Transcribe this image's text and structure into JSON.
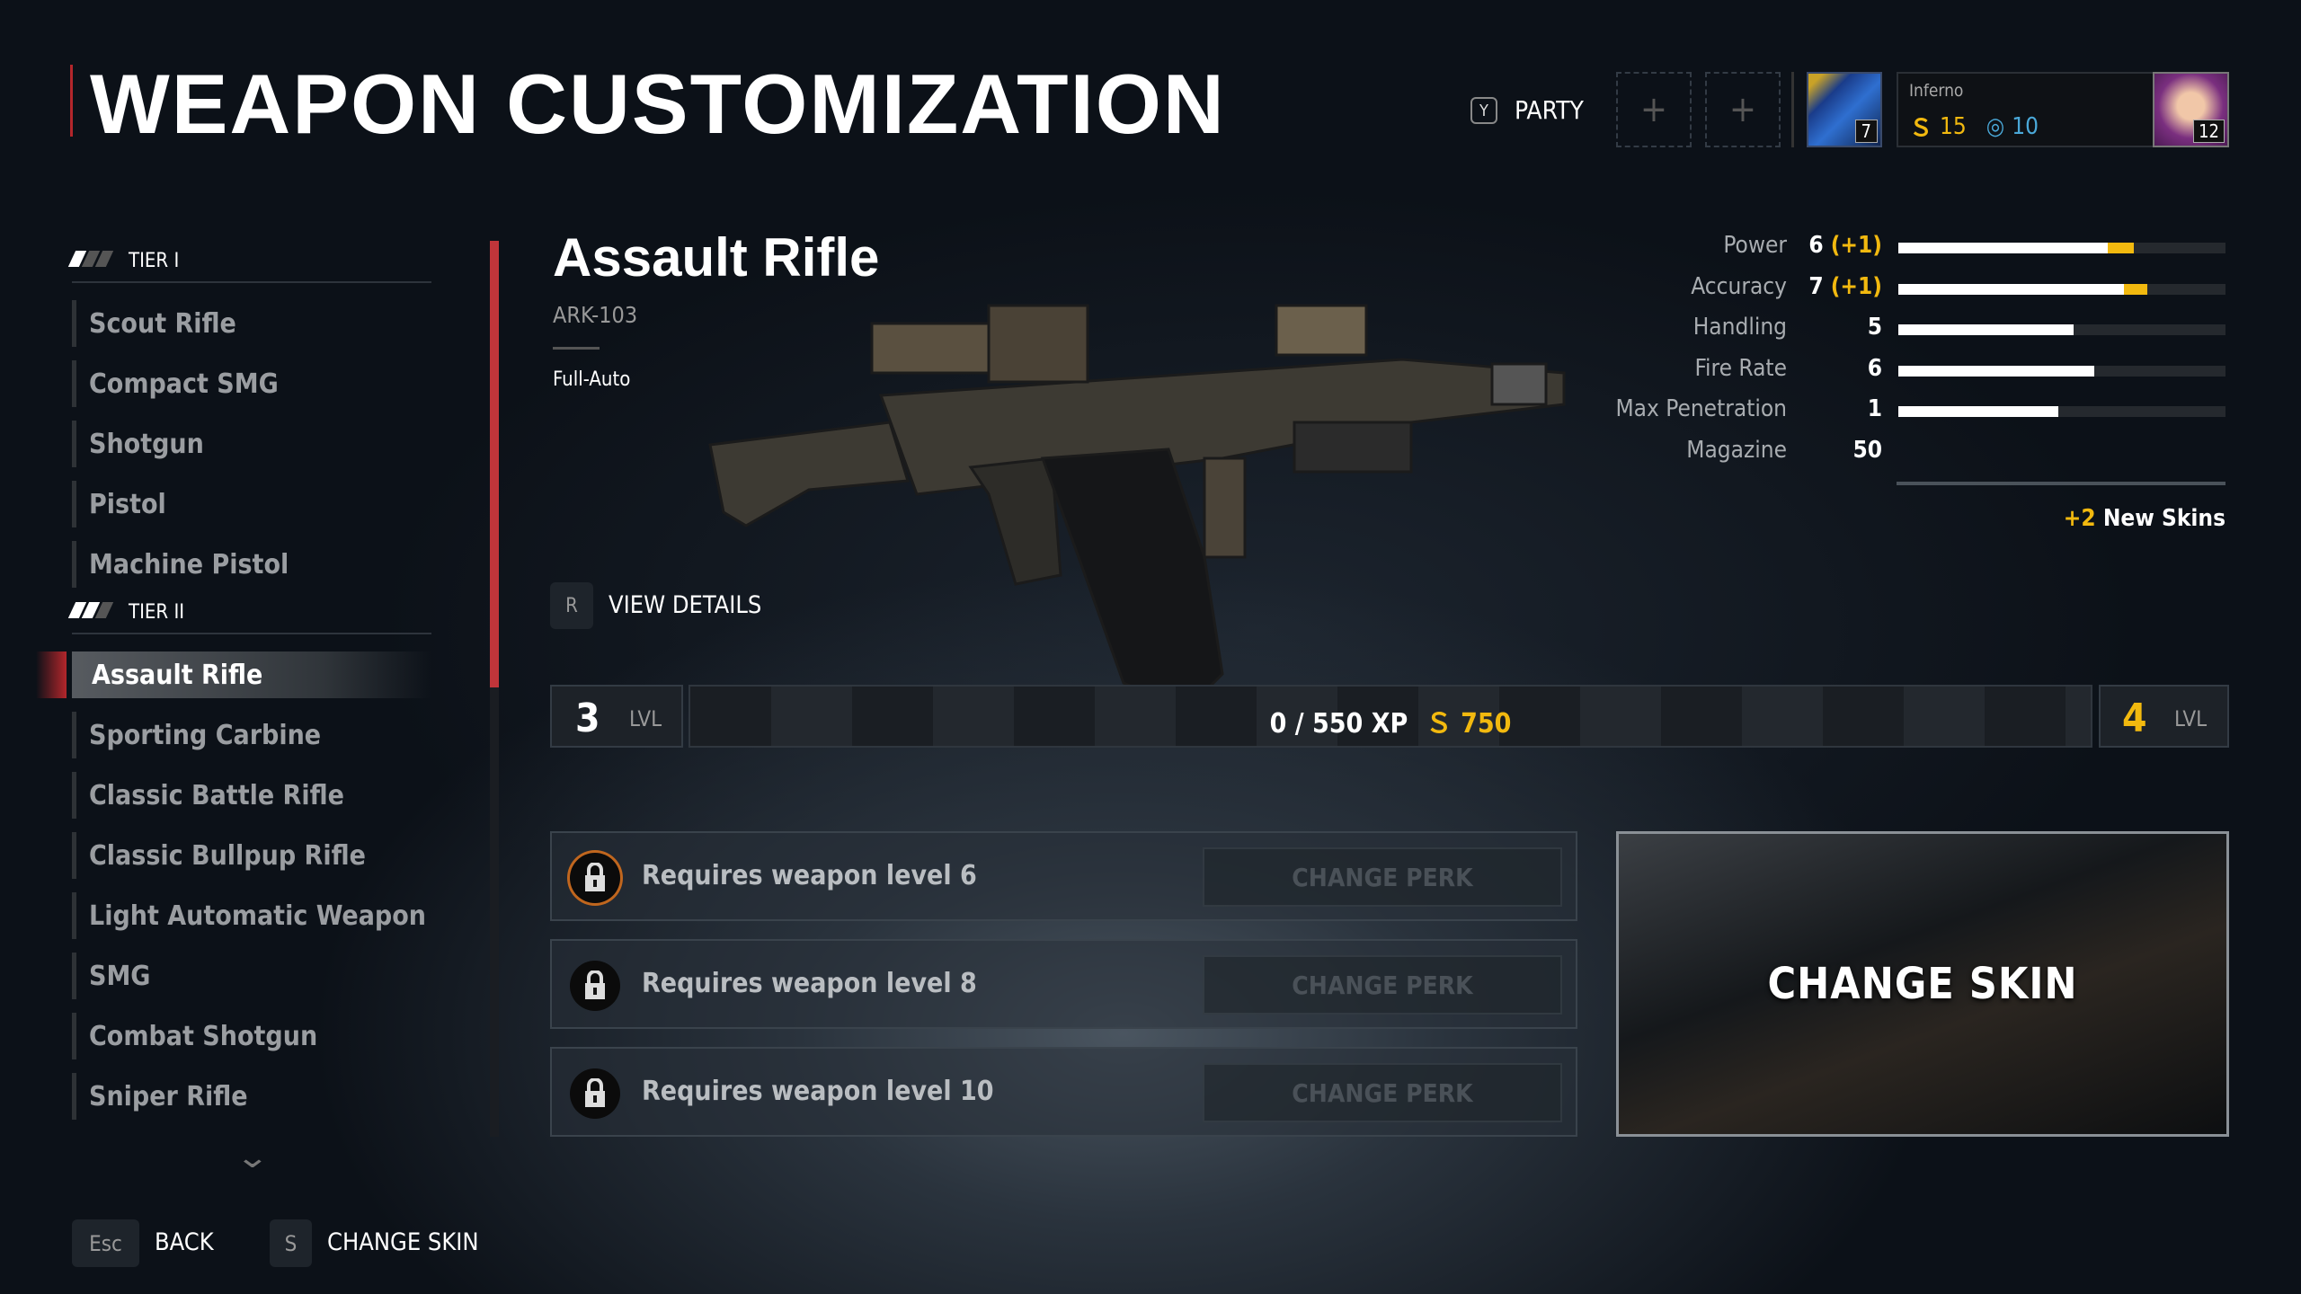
{
  "header": {
    "title": "WEAPON CUSTOMIZATION",
    "party_key": "Y",
    "party_label": "PARTY",
    "slot_plus": "+",
    "squad_level": "7",
    "player_name": "Inferno",
    "currency_gold": "15",
    "currency_blue": "10",
    "player_level": "12"
  },
  "sidebar": {
    "tiers": [
      {
        "label": "TIER I",
        "items": [
          "Scout Rifle",
          "Compact SMG",
          "Shotgun",
          "Pistol",
          "Machine Pistol"
        ]
      },
      {
        "label": "TIER II",
        "items": [
          "Assault Rifle",
          "Sporting Carbine",
          "Classic Battle Rifle",
          "Classic Bullpup Rifle",
          "Light Automatic Weapon",
          "SMG",
          "Combat Shotgun",
          "Sniper Rifle"
        ]
      }
    ],
    "selected": "Assault Rifle",
    "scroll_fraction": 0.5
  },
  "weapon": {
    "name": "Assault Rifle",
    "model": "ARK-103",
    "fire_mode": "Full-Auto",
    "view_key": "R",
    "view_label": "VIEW DETAILS"
  },
  "stats": [
    {
      "label": "Power",
      "value": "6",
      "bonus": "(+1)",
      "fill": 0.64,
      "bonus_fill": 0.72
    },
    {
      "label": "Accuracy",
      "value": "7",
      "bonus": "(+1)",
      "fill": 0.69,
      "bonus_fill": 0.76
    },
    {
      "label": "Handling",
      "value": "5",
      "fill": 0.535
    },
    {
      "label": "Fire Rate",
      "value": "6",
      "fill": 0.6
    },
    {
      "label": "Max Penetration",
      "value": "1",
      "fill": 0.49
    },
    {
      "label": "Magazine",
      "value": "50"
    }
  ],
  "new_skins": {
    "count": "+2",
    "label": "New Skins"
  },
  "xp": {
    "current_level": "3",
    "next_level": "4",
    "lvl_label": "LVL",
    "progress": "0 / 550 XP",
    "reward": "750",
    "fraction": 0
  },
  "perks": [
    {
      "text": "Requires weapon level 6",
      "button": "CHANGE PERK"
    },
    {
      "text": "Requires weapon level 8",
      "button": "CHANGE PERK"
    },
    {
      "text": "Requires weapon level 10",
      "button": "CHANGE PERK"
    }
  ],
  "skin_panel": {
    "label": "CHANGE SKIN"
  },
  "footer": {
    "back_key": "Esc",
    "back_label": "BACK",
    "skin_key": "S",
    "skin_label": "CHANGE SKIN"
  },
  "colors": {
    "accent_red": "#b3262b",
    "gold": "#f2b90f",
    "blue_currency": "#4aa8d8"
  }
}
